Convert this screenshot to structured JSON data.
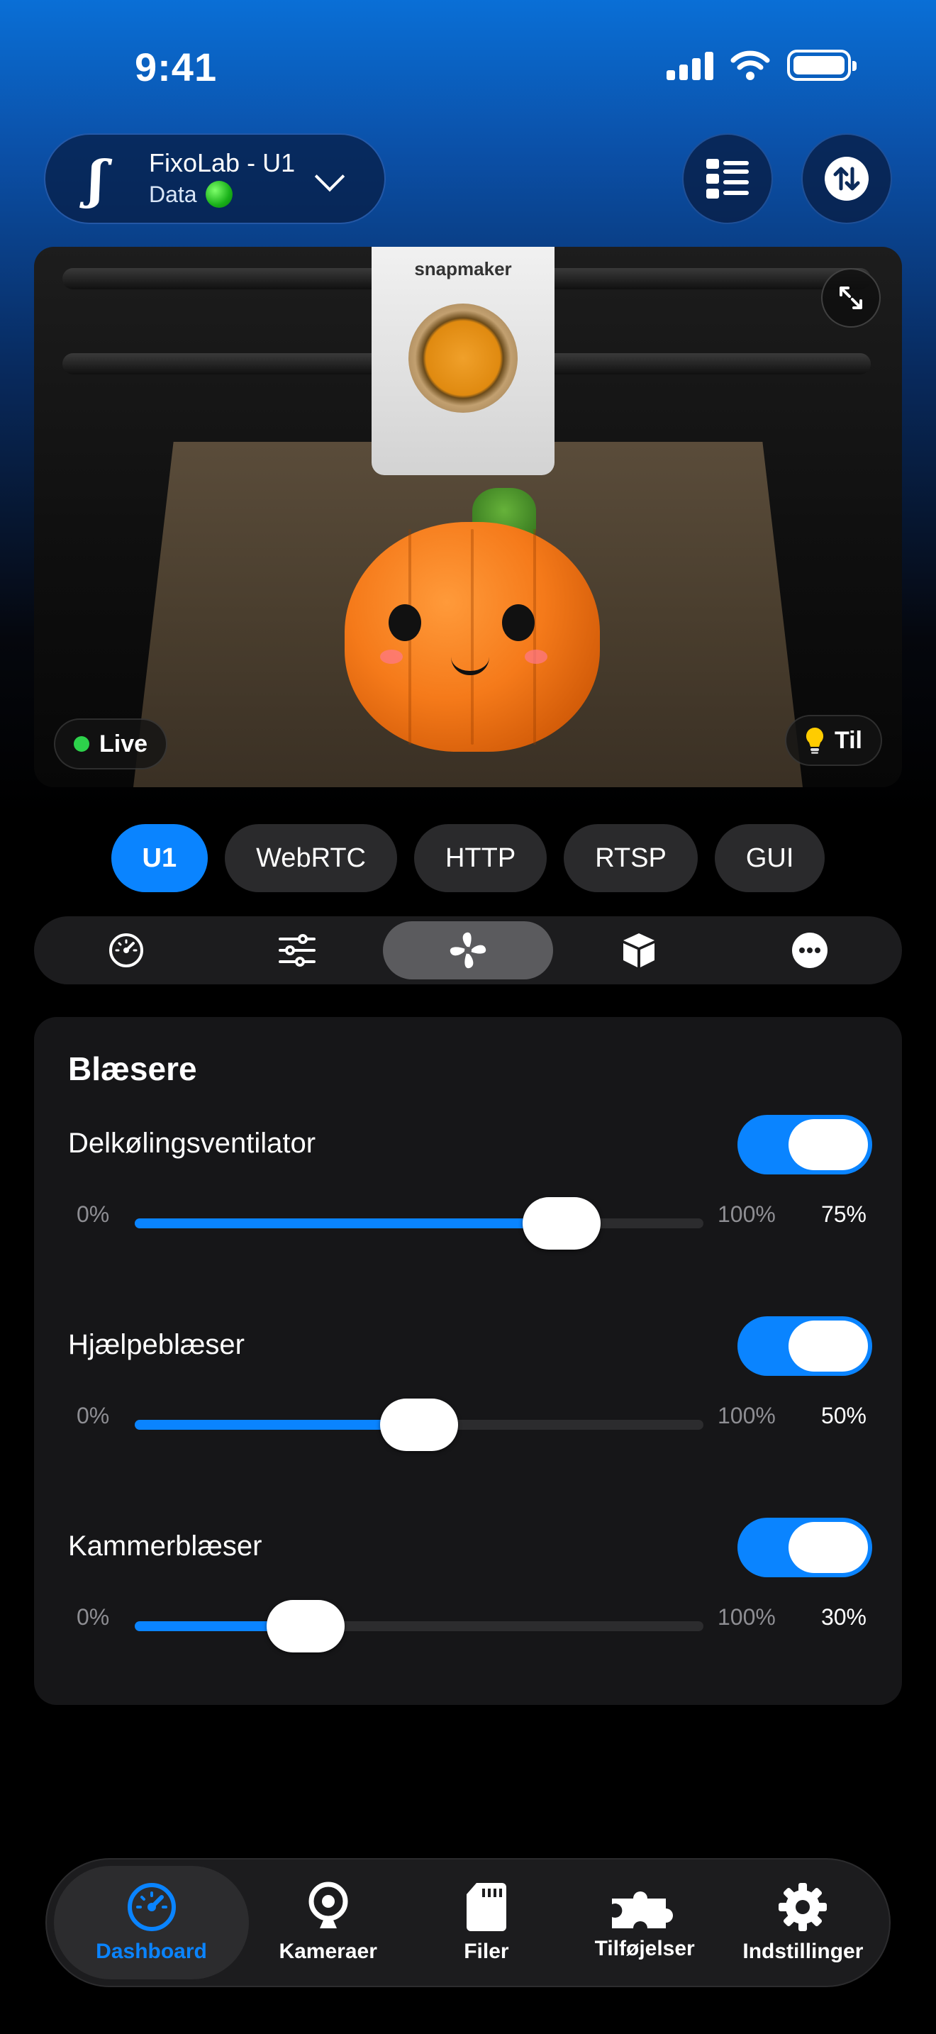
{
  "status_bar": {
    "time": "9:41"
  },
  "header": {
    "printer_name": "FixoLab - U1",
    "printer_status": "Data"
  },
  "camera": {
    "brand_label": "snapmaker",
    "live_label": "Live",
    "light_label": "Til"
  },
  "source_tabs": [
    {
      "label": "U1",
      "active": true
    },
    {
      "label": "WebRTC",
      "active": false
    },
    {
      "label": "HTTP",
      "active": false
    },
    {
      "label": "RTSP",
      "active": false
    },
    {
      "label": "GUI",
      "active": false
    }
  ],
  "section_tabs": [
    {
      "icon": "speedometer-icon",
      "active": false
    },
    {
      "icon": "sliders-icon",
      "active": false
    },
    {
      "icon": "fan-icon",
      "active": true
    },
    {
      "icon": "box-icon",
      "active": false
    },
    {
      "icon": "more-icon",
      "active": false
    }
  ],
  "fans": {
    "title": "Blæsere",
    "items": [
      {
        "name": "Delkølingsventilator",
        "enabled": true,
        "value": 75,
        "min_label": "0%",
        "max_label": "100%",
        "value_label": "75%"
      },
      {
        "name": "Hjælpeblæser",
        "enabled": true,
        "value": 50,
        "min_label": "0%",
        "max_label": "100%",
        "value_label": "50%"
      },
      {
        "name": "Kammerblæser",
        "enabled": true,
        "value": 30,
        "min_label": "0%",
        "max_label": "100%",
        "value_label": "30%"
      }
    ]
  },
  "bottom_nav": [
    {
      "label": "Dashboard",
      "icon": "speedometer-icon",
      "active": true
    },
    {
      "label": "Kameraer",
      "icon": "webcam-icon",
      "active": false
    },
    {
      "label": "Filer",
      "icon": "sd-card-icon",
      "active": false
    },
    {
      "label": "Tilføjelser",
      "icon": "puzzle-icon",
      "active": false
    },
    {
      "label": "Indstillinger",
      "icon": "gear-icon",
      "active": false
    }
  ],
  "colors": {
    "accent": "#0a84ff",
    "live": "#2dd24b",
    "card_bg": "#161618"
  }
}
